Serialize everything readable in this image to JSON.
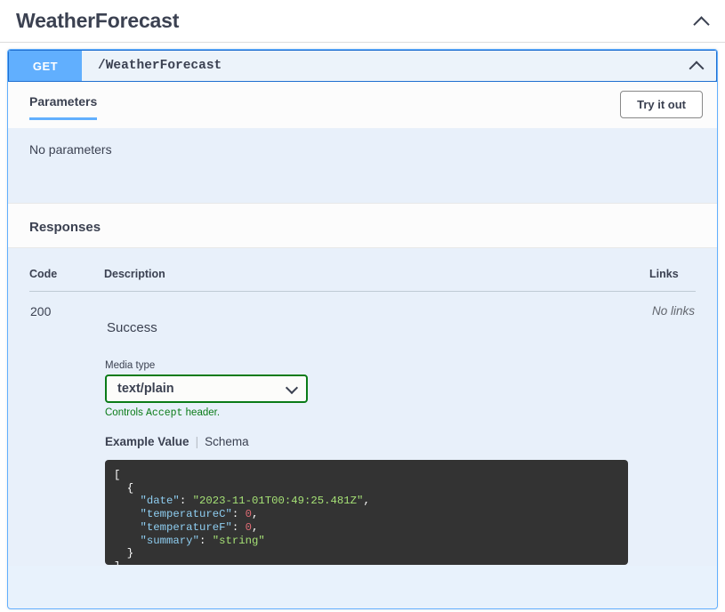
{
  "tag": {
    "title": "WeatherForecast",
    "collapse_icon": "chevron-up-icon"
  },
  "operation": {
    "method": "GET",
    "path": "/WeatherForecast",
    "collapse_icon": "chevron-up-icon",
    "method_color": "#61affe"
  },
  "parameters": {
    "tab_label": "Parameters",
    "try_it_out_label": "Try it out",
    "empty_text": "No parameters"
  },
  "responses": {
    "heading": "Responses",
    "columns": {
      "code": "Code",
      "description": "Description",
      "links": "Links"
    },
    "rows": [
      {
        "code": "200",
        "description": "Success",
        "links": "No links",
        "media_type": {
          "label": "Media type",
          "value": "text/plain",
          "hint_prefix": "Controls ",
          "hint_mono": "Accept",
          "hint_suffix": " header.",
          "border_color": "#0a7b18",
          "dropdown_icon": "chevron-down-icon"
        },
        "example_tabs": {
          "active": "Example Value",
          "inactive": "Schema"
        },
        "example_code": {
          "lines": [
            {
              "indent": 0,
              "tokens": [
                {
                  "t": "[",
                  "c": "p"
                }
              ]
            },
            {
              "indent": 1,
              "tokens": [
                {
                  "t": "{",
                  "c": "p"
                }
              ]
            },
            {
              "indent": 2,
              "tokens": [
                {
                  "t": "\"date\"",
                  "c": "k"
                },
                {
                  "t": ": ",
                  "c": "p"
                },
                {
                  "t": "\"2023-11-01T00:49:25.481Z\"",
                  "c": "s"
                },
                {
                  "t": ",",
                  "c": "p"
                }
              ]
            },
            {
              "indent": 2,
              "tokens": [
                {
                  "t": "\"temperatureC\"",
                  "c": "k"
                },
                {
                  "t": ": ",
                  "c": "p"
                },
                {
                  "t": "0",
                  "c": "n"
                },
                {
                  "t": ",",
                  "c": "p"
                }
              ]
            },
            {
              "indent": 2,
              "tokens": [
                {
                  "t": "\"temperatureF\"",
                  "c": "k"
                },
                {
                  "t": ": ",
                  "c": "p"
                },
                {
                  "t": "0",
                  "c": "n"
                },
                {
                  "t": ",",
                  "c": "p"
                }
              ]
            },
            {
              "indent": 2,
              "tokens": [
                {
                  "t": "\"summary\"",
                  "c": "k"
                },
                {
                  "t": ": ",
                  "c": "p"
                },
                {
                  "t": "\"string\"",
                  "c": "s"
                }
              ]
            },
            {
              "indent": 1,
              "tokens": [
                {
                  "t": "}",
                  "c": "p"
                }
              ]
            },
            {
              "indent": 0,
              "tokens": [
                {
                  "t": "]",
                  "c": "p"
                }
              ]
            }
          ]
        }
      }
    ]
  }
}
